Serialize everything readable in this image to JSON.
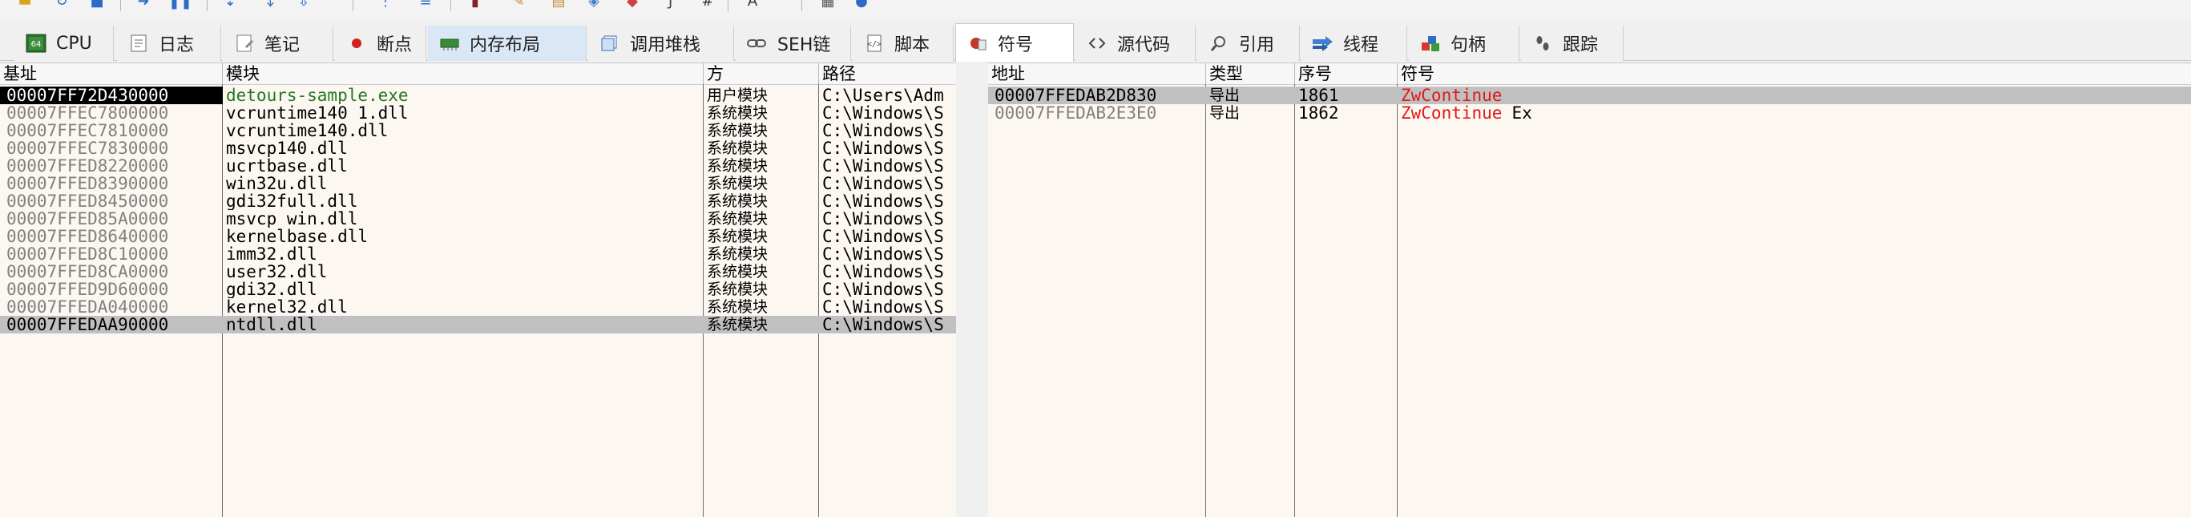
{
  "toolbar": {
    "icons": [
      "folder-open-icon",
      "restart-icon",
      "stop-icon",
      "run-icon",
      "pause-icon",
      "step-into-icon",
      "step-over-icon",
      "execute-till-return-icon",
      "run-to-user-code-icon",
      "trace-icon",
      "bug-icon",
      "pen-icon",
      "patch-icon",
      "tag-icon",
      "bookmark-icon",
      "function-icon",
      "hash-icon",
      "font-icon",
      "calculator-icon",
      "globe-icon"
    ]
  },
  "tabs": [
    {
      "label": "CPU",
      "icon": "cpu-icon"
    },
    {
      "label": "日志",
      "icon": "log-icon"
    },
    {
      "label": "笔记",
      "icon": "notes-icon"
    },
    {
      "label": "断点",
      "icon": "breakpoint-icon"
    },
    {
      "label": "内存布局",
      "icon": "memory-map-icon"
    },
    {
      "label": "调用堆栈",
      "icon": "call-stack-icon"
    },
    {
      "label": "SEH链",
      "icon": "seh-chain-icon"
    },
    {
      "label": "脚本",
      "icon": "script-icon"
    },
    {
      "label": "符号",
      "icon": "symbols-icon"
    },
    {
      "label": "源代码",
      "icon": "source-code-icon"
    },
    {
      "label": "引用",
      "icon": "references-icon"
    },
    {
      "label": "线程",
      "icon": "threads-icon"
    },
    {
      "label": "句柄",
      "icon": "handles-icon"
    },
    {
      "label": "跟踪",
      "icon": "trace-footprints-icon"
    }
  ],
  "modules": {
    "headers": [
      "基址",
      "模块",
      "方",
      "路径"
    ],
    "rows": [
      {
        "base": "00007FF72D430000",
        "module": "detours-sample.exe",
        "type": "用户模块",
        "path": "C:\\Users\\Adm"
      },
      {
        "base": "00007FFEC7800000",
        "module": "vcruntime140_1.dll",
        "type": "系统模块",
        "path": "C:\\Windows\\S"
      },
      {
        "base": "00007FFEC7810000",
        "module": "vcruntime140.dll",
        "type": "系统模块",
        "path": "C:\\Windows\\S"
      },
      {
        "base": "00007FFEC7830000",
        "module": "msvcp140.dll",
        "type": "系统模块",
        "path": "C:\\Windows\\S"
      },
      {
        "base": "00007FFED8220000",
        "module": "ucrtbase.dll",
        "type": "系统模块",
        "path": "C:\\Windows\\S"
      },
      {
        "base": "00007FFED8390000",
        "module": "win32u.dll",
        "type": "系统模块",
        "path": "C:\\Windows\\S"
      },
      {
        "base": "00007FFED8450000",
        "module": "gdi32full.dll",
        "type": "系统模块",
        "path": "C:\\Windows\\S"
      },
      {
        "base": "00007FFED85A0000",
        "module": "msvcp_win.dll",
        "type": "系统模块",
        "path": "C:\\Windows\\S"
      },
      {
        "base": "00007FFED8640000",
        "module": "kernelbase.dll",
        "type": "系统模块",
        "path": "C:\\Windows\\S"
      },
      {
        "base": "00007FFED8C10000",
        "module": "imm32.dll",
        "type": "系统模块",
        "path": "C:\\Windows\\S"
      },
      {
        "base": "00007FFED8CA0000",
        "module": "user32.dll",
        "type": "系统模块",
        "path": "C:\\Windows\\S"
      },
      {
        "base": "00007FFED9D60000",
        "module": "gdi32.dll",
        "type": "系统模块",
        "path": "C:\\Windows\\S"
      },
      {
        "base": "00007FFEDA040000",
        "module": "kernel32.dll",
        "type": "系统模块",
        "path": "C:\\Windows\\S"
      },
      {
        "base": "00007FFEDAA90000",
        "module": "ntdll.dll",
        "type": "系统模块",
        "path": "C:\\Windows\\S"
      }
    ]
  },
  "symbols": {
    "headers": [
      "地址",
      "类型",
      "序号",
      "符号"
    ],
    "rows": [
      {
        "address": "00007FFEDAB2D830",
        "type": "导出",
        "ordinal": "1861",
        "symbol": "ZwContinue",
        "suffix": ""
      },
      {
        "address": "00007FFEDAB2E3E0",
        "type": "导出",
        "ordinal": "1862",
        "symbol": "ZwContinue",
        "suffix": "Ex"
      }
    ]
  },
  "colors": {
    "pane_bg": "#fdf7f1",
    "selected_row": "#c0c0c0",
    "user_module": "#227722",
    "symbol_name": "#e01818",
    "dim_address": "#808080"
  }
}
